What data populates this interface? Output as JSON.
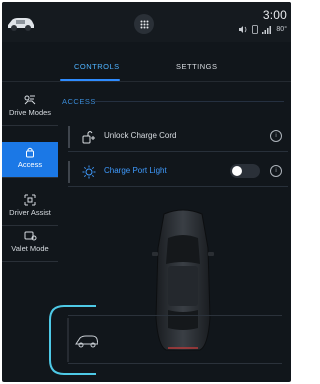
{
  "statusbar": {
    "time": "3:00",
    "icons": [
      "car-thumbnail-icon",
      "apps-grid-icon",
      "volume-icon",
      "phone-icon",
      "signal-icon"
    ],
    "temperature": "80°"
  },
  "tabs": [
    {
      "label": "CONTROLS",
      "active": true
    },
    {
      "label": "SETTINGS",
      "active": false
    }
  ],
  "sidebar": {
    "items": [
      {
        "label": "Drive Modes",
        "icon": "drive-modes-icon",
        "active": false
      },
      {
        "label": "Access",
        "icon": "lock-icon",
        "active": true
      },
      {
        "label": "Driver Assist",
        "icon": "driver-assist-icon",
        "active": false
      },
      {
        "label": "Valet Mode",
        "icon": "valet-icon",
        "active": false
      }
    ]
  },
  "access": {
    "section_title": "ACCESS",
    "rows": [
      {
        "label": "Unlock Charge Cord",
        "icon": "charge-cord-icon"
      },
      {
        "label": "Charge Port Light",
        "icon": "charge-port-light-icon",
        "toggle_on": false
      }
    ]
  },
  "colors": {
    "accent": "#1b78e6",
    "accent_text": "#4fb3ff",
    "background": "#11161b"
  }
}
